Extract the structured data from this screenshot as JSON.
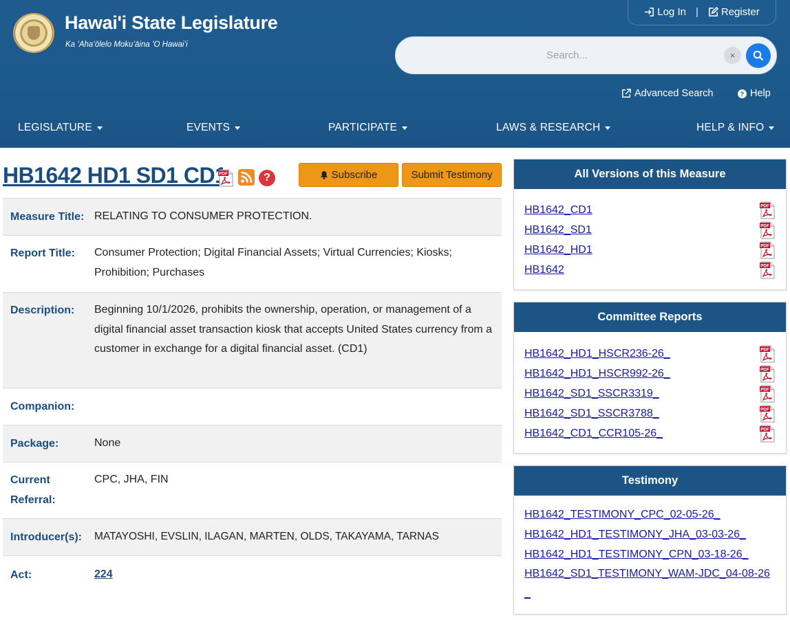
{
  "header": {
    "title": "Hawai'i State Legislature",
    "subtitle": "Ka ʻAhaʻōlelo Mokuʻāina ʻO Hawaiʻi",
    "login": "Log In",
    "separator": "|",
    "register": "Register",
    "search_placeholder": "Search...",
    "clear": "×",
    "advanced_search": "Advanced Search",
    "help": "Help"
  },
  "nav": [
    "LEGISLATURE",
    "EVENTS",
    "PARTICIPATE",
    "LAWS & RESEARCH",
    "HELP & INFO"
  ],
  "measure": {
    "id": "HB1642 HD1 SD1 CD1",
    "subscribe": "Subscribe",
    "submit_testimony": "Submit Testimony",
    "help_glyph": "?",
    "fields": {
      "measure_title_label": "Measure Title:",
      "measure_title": "RELATING TO CONSUMER PROTECTION.",
      "report_title_label": "Report Title:",
      "report_title": "Consumer Protection; Digital Financial Assets; Virtual Currencies; Kiosks; Prohibition; Purchases",
      "description_label": "Description:",
      "description": "Beginning 10/1/2026, prohibits the ownership, operation, or management of a digital financial asset transaction kiosk that accepts United States currency from a customer in exchange for a digital financial asset. (CD1)",
      "companion_label": "Companion:",
      "companion": "",
      "package_label": "Package:",
      "package": "None",
      "referral_label": "Current Referral:",
      "referral": "CPC, JHA, FIN",
      "introducers_label": "Introducer(s):",
      "introducers": "MATAYOSHI, EVSLIN, ILAGAN, MARTEN, OLDS, TAKAYAMA, TARNAS",
      "act_label": "Act:",
      "act": "224"
    }
  },
  "versions": {
    "title": "All Versions of this Measure",
    "items": [
      "HB1642_CD1",
      "HB1642_SD1",
      "HB1642_HD1",
      "HB1642"
    ]
  },
  "committee_reports": {
    "title": "Committee Reports",
    "items": [
      "HB1642_HD1_HSCR236-26_",
      "HB1642_HD1_HSCR992-26_",
      "HB1642_SD1_SSCR3319_",
      "HB1642_SD1_SSCR3788_",
      "HB1642_CD1_CCR105-26_"
    ]
  },
  "testimony": {
    "title": "Testimony",
    "items": [
      "HB1642_TESTIMONY_CPC_02-05-26_",
      "HB1642_HD1_TESTIMONY_JHA_03-03-26_",
      "HB1642_HD1_TESTIMONY_CPN_03-18-26_",
      "HB1642_SD1_TESTIMONY_WAM-JDC_04-08-26_"
    ]
  }
}
